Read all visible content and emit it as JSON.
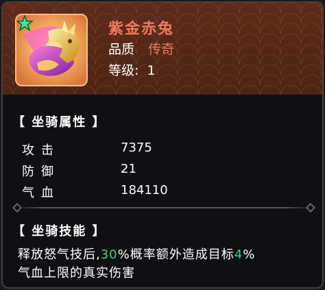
{
  "mount": {
    "name": "紫金赤兔",
    "quality_label": "品质",
    "quality_value": "传奇",
    "level_label": "等级:",
    "level_value": "1",
    "icon": "golden-horse-mount-icon",
    "rarity_icon": "green-star-icon"
  },
  "attributes": {
    "title": "【 坐骑属性 】",
    "stats": [
      {
        "label": "攻击",
        "value": "7375"
      },
      {
        "label": "防御",
        "value": "21"
      },
      {
        "label": "气血",
        "value": "184110"
      }
    ]
  },
  "skill": {
    "title": "【 坐骑技能 】",
    "text_1": "释放怒气技后,",
    "pct_1": "30",
    "text_2": "%概率额外造成目标",
    "pct_2": "4",
    "text_3": "%",
    "text_4": "气血上限的真实伤害"
  },
  "colors": {
    "title": "#f07a5c",
    "highlight": "#3ccf86",
    "header_bg": "#5a2a1a"
  }
}
